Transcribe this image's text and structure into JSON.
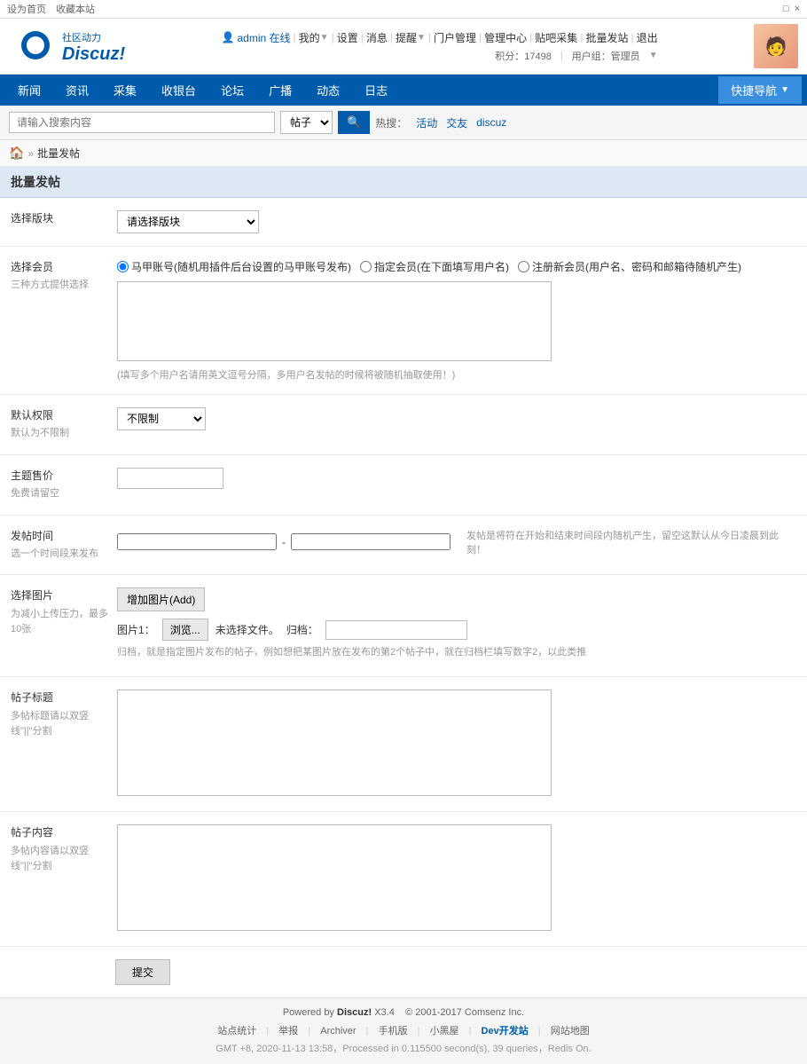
{
  "topbar": {
    "left_links": [
      "设为首页",
      "收藏本站"
    ],
    "close_label": "×",
    "restore_label": "□"
  },
  "header": {
    "logo_brand": "社区动力",
    "logo_name": "Discuz!",
    "user_label": "admin 在线",
    "user_menu": "我的",
    "links": [
      "设置",
      "消息",
      "提醒",
      "门户管理",
      "管理中心",
      "贴吧采集",
      "批量发站",
      "退出"
    ],
    "score_label": "积分：17498",
    "usergroup_label": "用户组：管理员"
  },
  "nav": {
    "items": [
      "新闻",
      "资讯",
      "采集",
      "收银台",
      "论坛",
      "广播",
      "动态",
      "日志"
    ],
    "quicknav_label": "快捷导航"
  },
  "searchbar": {
    "placeholder": "请输入搜索内容",
    "type_options": [
      "帖子"
    ],
    "btn_label": "🔍",
    "hot_label": "热搜：",
    "hot_items": [
      "活动",
      "交友",
      "discuz"
    ]
  },
  "breadcrumb": {
    "home_label": "🏠",
    "sep": "»",
    "current": "批量发帖"
  },
  "page": {
    "title": "批量发帖",
    "form": {
      "select_forum": {
        "label": "选择版块",
        "placeholder": "请选择版块"
      },
      "select_member": {
        "label": "选择会员",
        "sublabel": "三种方式提供选择",
        "radio_options": [
          "马甲账号(随机用插件后台设置的马甲账号发布)",
          "指定会员(在下面填写用户名)",
          "注册新会员(用户名、密码和邮箱待随机产生)"
        ],
        "textarea_placeholder": "",
        "hint": "(填写多个用户名请用英文逗号分隔，多用户名发帖的时候将被随机抽取使用！)"
      },
      "default_permission": {
        "label": "默认权限",
        "sublabel": "默认为不限制",
        "options": [
          "不限制"
        ],
        "value": "不限制"
      },
      "topic_price": {
        "label": "主题售价",
        "sublabel": "免费请留空",
        "value": ""
      },
      "post_time": {
        "label": "发帖时间",
        "sublabel": "选一个时间段来发布",
        "from": "",
        "to": "",
        "hint": "发帖是将符在开始和结束时间段内随机产生，留空这默认从今日凌晨到此刻！"
      },
      "select_image": {
        "label": "选择图片",
        "sublabel": "为减小上传压力，最多10张",
        "add_btn": "增加图片(Add)",
        "img1_label": "图片1：",
        "browse_label": "浏览...",
        "no_file": "未选择文件。",
        "archive_label": "归档：",
        "archive_value": "",
        "note": "归档，就是指定图片发布的帖子，例如想把某图片放在发布的第2个帖子中，就在归档栏填写数字2，以此类推"
      },
      "post_title": {
        "label": "帖子标题",
        "sublabel": "多帖标题请以双竖线\"||\"分割",
        "value": ""
      },
      "post_content": {
        "label": "帖子内容",
        "sublabel": "多帖内容请以双竖线\"||\"分割",
        "value": ""
      },
      "submit_label": "提交"
    }
  },
  "footer": {
    "powered_by": "Powered by",
    "brand": "Discuz!",
    "version": "X3.4",
    "copyright": "© 2001-2017 Comsenz Inc.",
    "links": [
      "站点统计",
      "举报",
      "Archiver",
      "手机版",
      "小黑屋",
      "Dev开发站",
      "网站地图"
    ],
    "dev_link": "Dev开发站",
    "server_info": "GMT +8, 2020-11-13 13:58，Processed in 0.115500 second(s), 39 queries，Redis On."
  }
}
